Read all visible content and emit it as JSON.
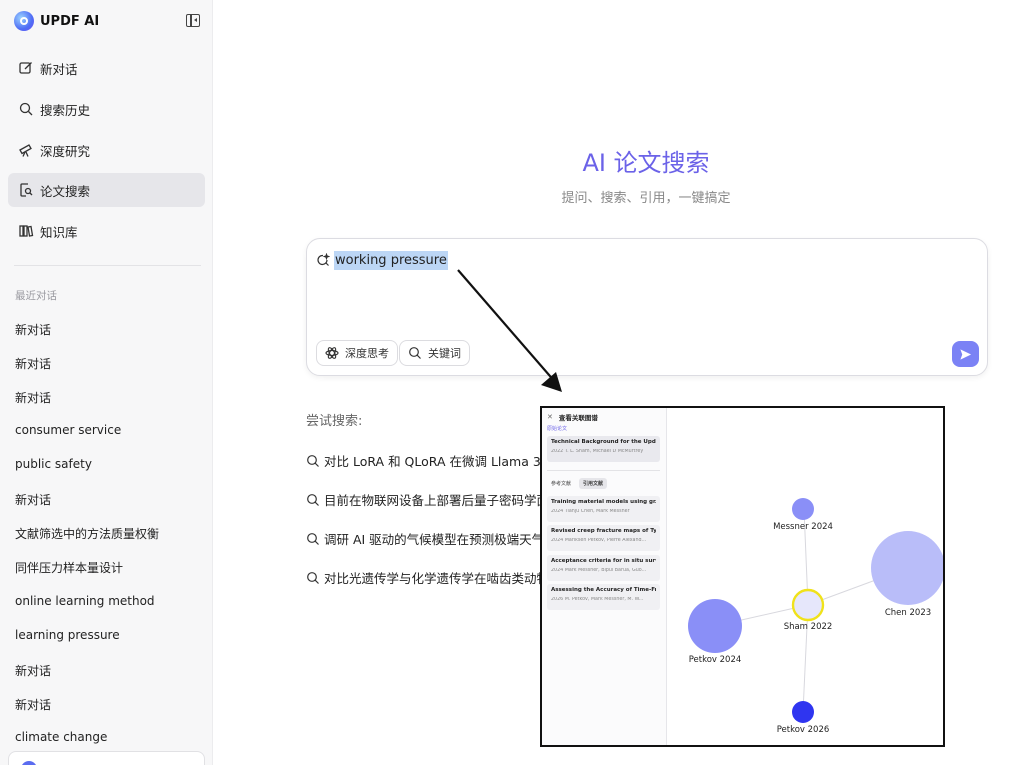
{
  "brand": {
    "name": "UPDF AI"
  },
  "nav": [
    {
      "label": "新对话",
      "icon": "edit-icon",
      "active": false
    },
    {
      "label": "搜索历史",
      "icon": "search-icon",
      "active": false
    },
    {
      "label": "深度研究",
      "icon": "telescope-icon",
      "active": false
    },
    {
      "label": "论文搜索",
      "icon": "paper-search-icon",
      "active": true
    },
    {
      "label": "知识库",
      "icon": "library-icon",
      "active": false
    }
  ],
  "recent": {
    "title": "最近对话",
    "items": [
      "新对话",
      "新对话",
      "新对话",
      "consumer service",
      "public safety",
      "新对话",
      "文献筛选中的方法质量权衡",
      "同伴压力样本量设计",
      "online learning method",
      "learning pressure",
      "新对话",
      "新对话",
      "climate change"
    ]
  },
  "main": {
    "title": "AI 论文搜索",
    "subtitle": "提问、搜索、引用，一键搞定",
    "query": "working pressure",
    "chips": {
      "deep_think": "深度思考",
      "keywords": "关键词"
    },
    "try_label": "尝试搜索:",
    "suggestions": [
      "对比 LoRA 和 QLoRA 在微调 Llama 3 模",
      "目前在物联网设备上部署后量子密码学面",
      "调研 AI 驱动的气候模型在预测极端天气事",
      "对比光遗传学与化学遗传学在啮齿类动物"
    ]
  },
  "popup": {
    "title": "查看关联图谱",
    "subtitle": "原始论文",
    "main_paper": {
      "title": "Technical Background for the Upd...",
      "year": "2022",
      "authors": "T. L. Sham, Michael D McMurtrey"
    },
    "tabs": [
      "参考文献",
      "引用文献"
    ],
    "papers": [
      {
        "title": "Training material models using gr...",
        "year": "2024",
        "authors": "Tianju Chen, Mark Messner"
      },
      {
        "title": "Revised creep fracture maps of Ty...",
        "year": "2024",
        "authors": "Mariksen Petkov, Pierre Alexand..."
      },
      {
        "title": "Acceptance criteria for in situ surv...",
        "year": "2024",
        "authors": "Mark Messner, Bipul Barua, Guo..."
      },
      {
        "title": "Assessing the Accuracy of Time-Fr...",
        "year": "2026",
        "authors": "M. Petkov, Mark Messner, M. W..."
      }
    ],
    "nodes": {
      "messner": "Messner 2024",
      "chen": "Chen 2023",
      "sham": "Sham 2022",
      "petkov2024": "Petkov 2024",
      "petkov2026": "Petkov 2026"
    }
  },
  "colors": {
    "accent": "#6b62e8",
    "send": "#7b82f5",
    "node_light": "#b9bdf9",
    "node_mid": "#8a8ff7",
    "node_dark": "#2f35f0",
    "node_focus": "#f0e21a"
  }
}
